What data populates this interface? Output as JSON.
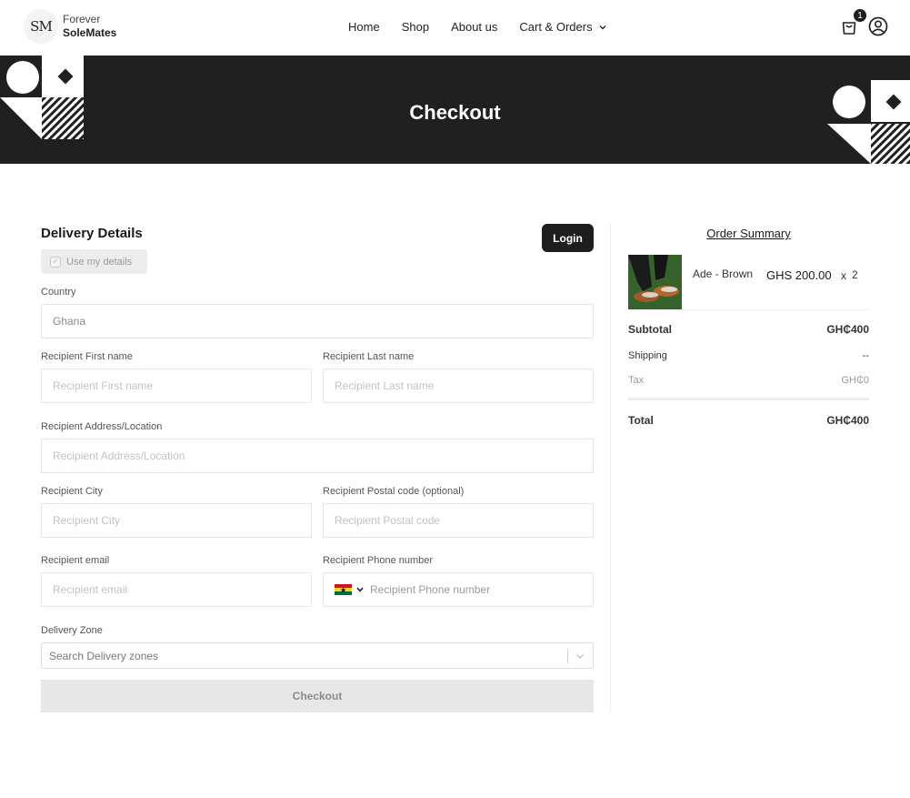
{
  "brand": {
    "line1": "Forever",
    "line2": "SoleMates",
    "badge": "SM"
  },
  "nav": {
    "items": [
      "Home",
      "Shop",
      "About us",
      "Cart & Orders"
    ]
  },
  "cart": {
    "count": "1"
  },
  "banner": {
    "title": "Checkout"
  },
  "form": {
    "title": "Delivery Details",
    "login_label": "Login",
    "use_my_details": "Use my details",
    "country": {
      "label": "Country",
      "value": "Ghana"
    },
    "first_name": {
      "label": "Recipient First name",
      "placeholder": "Recipient First name"
    },
    "last_name": {
      "label": "Recipient Last name",
      "placeholder": "Recipient Last name"
    },
    "address": {
      "label": "Recipient Address/Location",
      "placeholder": "Recipient Address/Location"
    },
    "city": {
      "label": "Recipient City",
      "placeholder": "Recipient City"
    },
    "postal": {
      "label": "Recipient Postal code (optional)",
      "placeholder": "Recipient Postal code"
    },
    "email": {
      "label": "Recipient email",
      "placeholder": "Recipient email"
    },
    "phone": {
      "label": "Recipient Phone number",
      "placeholder": "Recipient Phone number"
    },
    "zone": {
      "label": "Delivery Zone",
      "placeholder": "Search Delivery zones"
    },
    "checkout_label": "Checkout"
  },
  "summary": {
    "title": "Order Summary",
    "item": {
      "name": "Ade - Brown",
      "price": "GHS 200.00",
      "x": "x",
      "qty": "2"
    },
    "subtotal": {
      "label": "Subtotal",
      "value": "GH₵400"
    },
    "shipping": {
      "label": "Shipping",
      "value": "--"
    },
    "tax": {
      "label": "Tax",
      "value": "GH₵0"
    },
    "total": {
      "label": "Total",
      "value": "GH₵400"
    }
  },
  "colors": {
    "dark": "#1e1e1e",
    "banner": "#202020",
    "ghana_red": "#ce1126",
    "ghana_gold": "#fcd116",
    "ghana_green": "#006b3f"
  }
}
